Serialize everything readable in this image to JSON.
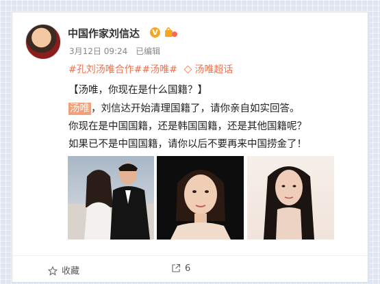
{
  "post": {
    "author": "中国作家刘信达",
    "verified_badge": "V",
    "meta": {
      "date": "3月12日 09:24",
      "edited": "已编辑"
    },
    "topics": {
      "tag1": "#孔刘汤唯合作#",
      "tag2": "#汤唯#",
      "supertopic": "汤唯超话"
    },
    "lines": {
      "l1": "【汤唯，你现在是什么国籍？】",
      "mention": "汤唯",
      "l2_rest": "，刘信达开始清理国籍了，请你亲自如实回答。",
      "l3": "你现在是中国国籍，还是韩国国籍，还是其他国籍呢？",
      "l4": "如果已不是中国国籍，请你以后不要再来中国捞金了！"
    }
  },
  "footer": {
    "favorite_label": "收藏",
    "share_count": "6"
  },
  "colors": {
    "accent": "#eb7350",
    "highlight": "#f0a07a",
    "badge": "#f5a623"
  }
}
